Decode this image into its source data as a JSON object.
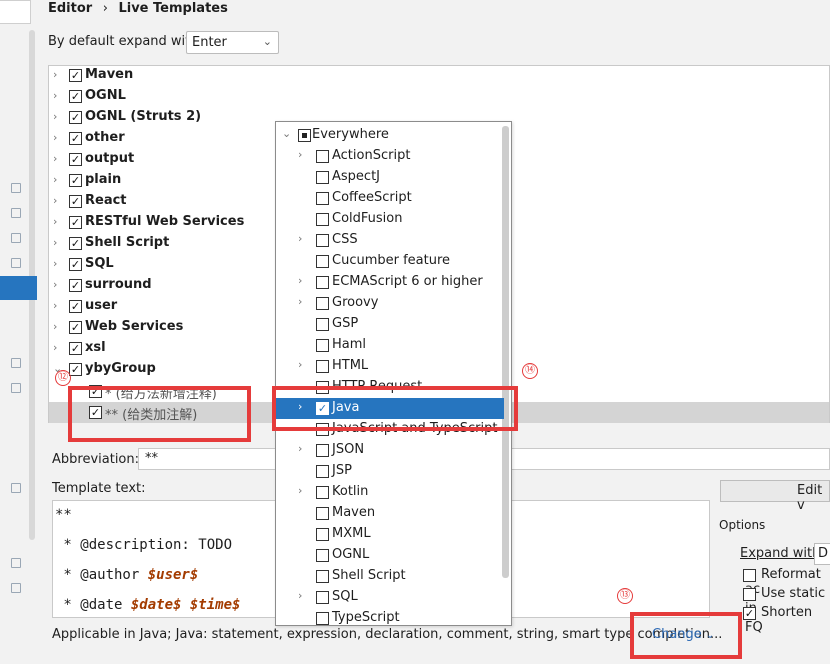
{
  "breadcrumb": {
    "parent": "Editor",
    "separator": "›",
    "current": "Live Templates"
  },
  "expand": {
    "label": "By default expand with",
    "value": "Enter"
  },
  "tree": {
    "groups": [
      {
        "label": "Maven"
      },
      {
        "label": "OGNL"
      },
      {
        "label": "OGNL (Struts 2)"
      },
      {
        "label": "other"
      },
      {
        "label": "output"
      },
      {
        "label": "plain"
      },
      {
        "label": "React"
      },
      {
        "label": "RESTful Web Services"
      },
      {
        "label": "Shell Script"
      },
      {
        "label": "SQL"
      },
      {
        "label": "surround"
      },
      {
        "label": "user"
      },
      {
        "label": "Web Services"
      },
      {
        "label": "xsl"
      },
      {
        "label": "ybyGroup"
      }
    ],
    "children": [
      {
        "label": "* (给方法新增注释)"
      },
      {
        "label": "** (给类加注解)"
      }
    ]
  },
  "popup": {
    "root": "Everywhere",
    "items": [
      {
        "label": "ActionScript",
        "expandable": true,
        "checked": false
      },
      {
        "label": "AspectJ",
        "expandable": false,
        "checked": false
      },
      {
        "label": "CoffeeScript",
        "expandable": false,
        "checked": false
      },
      {
        "label": "ColdFusion",
        "expandable": false,
        "checked": false
      },
      {
        "label": "CSS",
        "expandable": true,
        "checked": false
      },
      {
        "label": "Cucumber feature",
        "expandable": false,
        "checked": false
      },
      {
        "label": "ECMAScript 6 or higher",
        "expandable": true,
        "checked": false
      },
      {
        "label": "Groovy",
        "expandable": true,
        "checked": false
      },
      {
        "label": "GSP",
        "expandable": false,
        "checked": false
      },
      {
        "label": "Haml",
        "expandable": false,
        "checked": false
      },
      {
        "label": "HTML",
        "expandable": true,
        "checked": false
      },
      {
        "label": "HTTP Request",
        "expandable": false,
        "checked": false
      },
      {
        "label": "Java",
        "expandable": true,
        "checked": true,
        "selected": true
      },
      {
        "label": "JavaScript and TypeScript",
        "expandable": false,
        "checked": false
      },
      {
        "label": "JSON",
        "expandable": true,
        "checked": false
      },
      {
        "label": "JSP",
        "expandable": false,
        "checked": false
      },
      {
        "label": "Kotlin",
        "expandable": true,
        "checked": false
      },
      {
        "label": "Maven",
        "expandable": false,
        "checked": false
      },
      {
        "label": "MXML",
        "expandable": false,
        "checked": false
      },
      {
        "label": "OGNL",
        "expandable": false,
        "checked": false
      },
      {
        "label": "Shell Script",
        "expandable": false,
        "checked": false
      },
      {
        "label": "SQL",
        "expandable": true,
        "checked": false
      },
      {
        "label": "TypeScript",
        "expandable": false,
        "checked": false
      }
    ]
  },
  "abbreviation": {
    "label": "Abbreviation:",
    "value": "**"
  },
  "template_text": {
    "label": "Template text:",
    "line1": "**",
    "line2": " * @description: TODO",
    "line3_prefix": " * @author ",
    "line3_var": "$user$",
    "line4_prefix": " * @date ",
    "line4_var1": "$date$",
    "line4_var2": "$time$"
  },
  "edit_button": "Edit v",
  "options": {
    "label": "Options",
    "expand_with": "Expand with",
    "expand_value": "D",
    "reformat": "Reformat ac",
    "use_static": "Use static in",
    "shorten": "Shorten FQ"
  },
  "applicable": "Applicable in Java; Java: statement, expression, declaration, comment, string, smart type completion...",
  "change": "Change",
  "annotations": {
    "a12": "⑫",
    "a13": "⑬",
    "a14": "⑭"
  },
  "colors": {
    "accent": "#2675bf",
    "annotation": "#e53b3b"
  }
}
